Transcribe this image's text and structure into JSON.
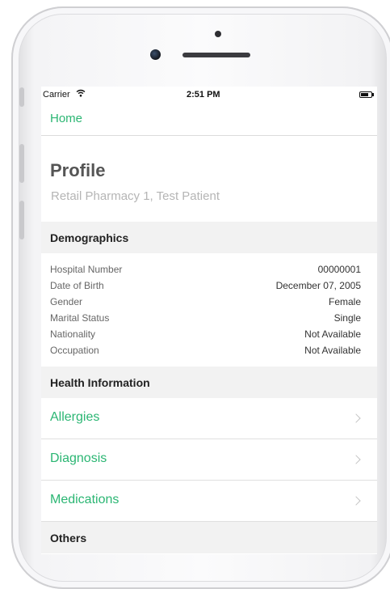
{
  "status_bar": {
    "carrier": "Carrier",
    "time": "2:51 PM"
  },
  "nav": {
    "back_label": "Home"
  },
  "profile": {
    "title": "Profile",
    "subtitle": "Retail Pharmacy 1, Test Patient"
  },
  "demographics": {
    "header": "Demographics",
    "rows": [
      {
        "label": "Hospital Number",
        "value": "00000001"
      },
      {
        "label": "Date of Birth",
        "value": "December 07, 2005"
      },
      {
        "label": "Gender",
        "value": "Female"
      },
      {
        "label": "Marital Status",
        "value": "Single"
      },
      {
        "label": "Nationality",
        "value": "Not Available"
      },
      {
        "label": "Occupation",
        "value": "Not Available"
      }
    ]
  },
  "health_information": {
    "header": "Health Information",
    "items": [
      {
        "label": "Allergies"
      },
      {
        "label": "Diagnosis"
      },
      {
        "label": "Medications"
      }
    ]
  },
  "others": {
    "header": "Others"
  },
  "colors": {
    "accent": "#2bb673",
    "section_bg": "#f2f2f2"
  }
}
